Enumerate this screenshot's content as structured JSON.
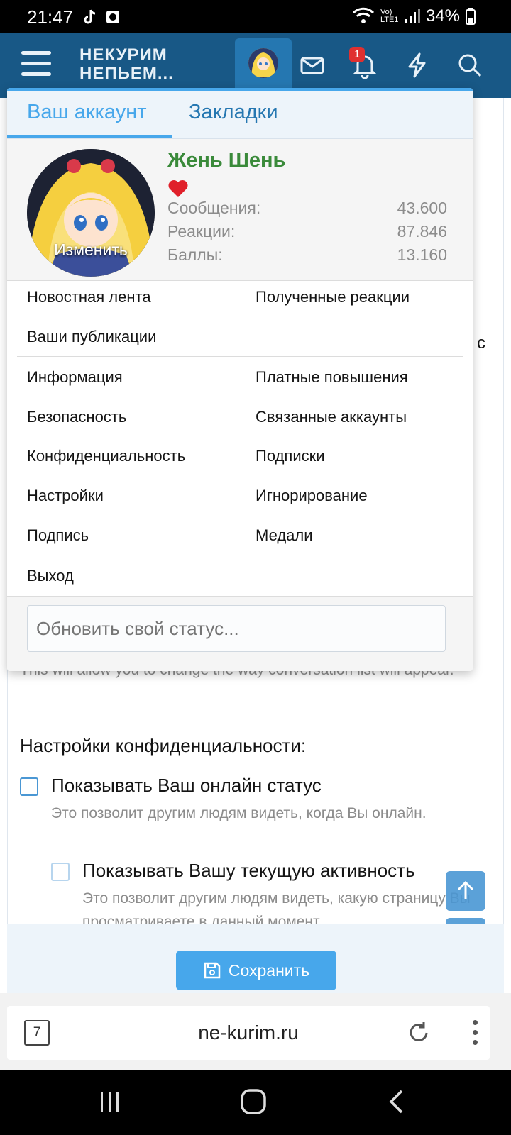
{
  "status_bar": {
    "time": "21:47",
    "lte_label": "Vo) LTE1",
    "battery": "34%"
  },
  "header": {
    "logo_line1": "НЕКУРИМ",
    "logo_line2": "НЕПЬЕМ...",
    "notification_count": "1"
  },
  "menu": {
    "tabs": [
      {
        "label": "Ваш аккаунт"
      },
      {
        "label": "Закладки"
      }
    ],
    "profile": {
      "username": "Жень Шень",
      "avatar_action": "Изменить",
      "stats": [
        {
          "label": "Сообщения:",
          "value": "43.600"
        },
        {
          "label": "Реакции:",
          "value": "87.846"
        },
        {
          "label": "Баллы:",
          "value": "13.160"
        }
      ]
    },
    "links_group1": [
      "Новостная лента",
      "Полученные реакции",
      "Ваши публикации"
    ],
    "links_group2": [
      "Информация",
      "Платные повышения",
      "Безопасность",
      "Связанные аккаунты",
      "Конфиденциальность",
      "Подписки",
      "Настройки",
      "Игнорирование",
      "Подпись",
      "Медали"
    ],
    "logout": "Выход",
    "status_placeholder": "Обновить свой статус..."
  },
  "page": {
    "stray_char": "с",
    "hint_text": "This will allow you to change the way conversation list will appear.",
    "privacy_heading": "Настройки конфиденциальности:",
    "options": [
      {
        "label": "Показывать Ваш онлайн статус",
        "hint": "Это позволит другим людям видеть, когда Вы онлайн."
      },
      {
        "label": "Показывать Вашу текущую активность",
        "hint": "Это позволит другим людям видеть, какую страницу Вы просматриваете в данный момент."
      }
    ],
    "save_label": "Сохранить"
  },
  "browser": {
    "tab_count": "7",
    "url": "ne-kurim.ru"
  },
  "colors": {
    "header": "#185886",
    "accent": "#47a7eb",
    "username": "#3a8a3a"
  }
}
